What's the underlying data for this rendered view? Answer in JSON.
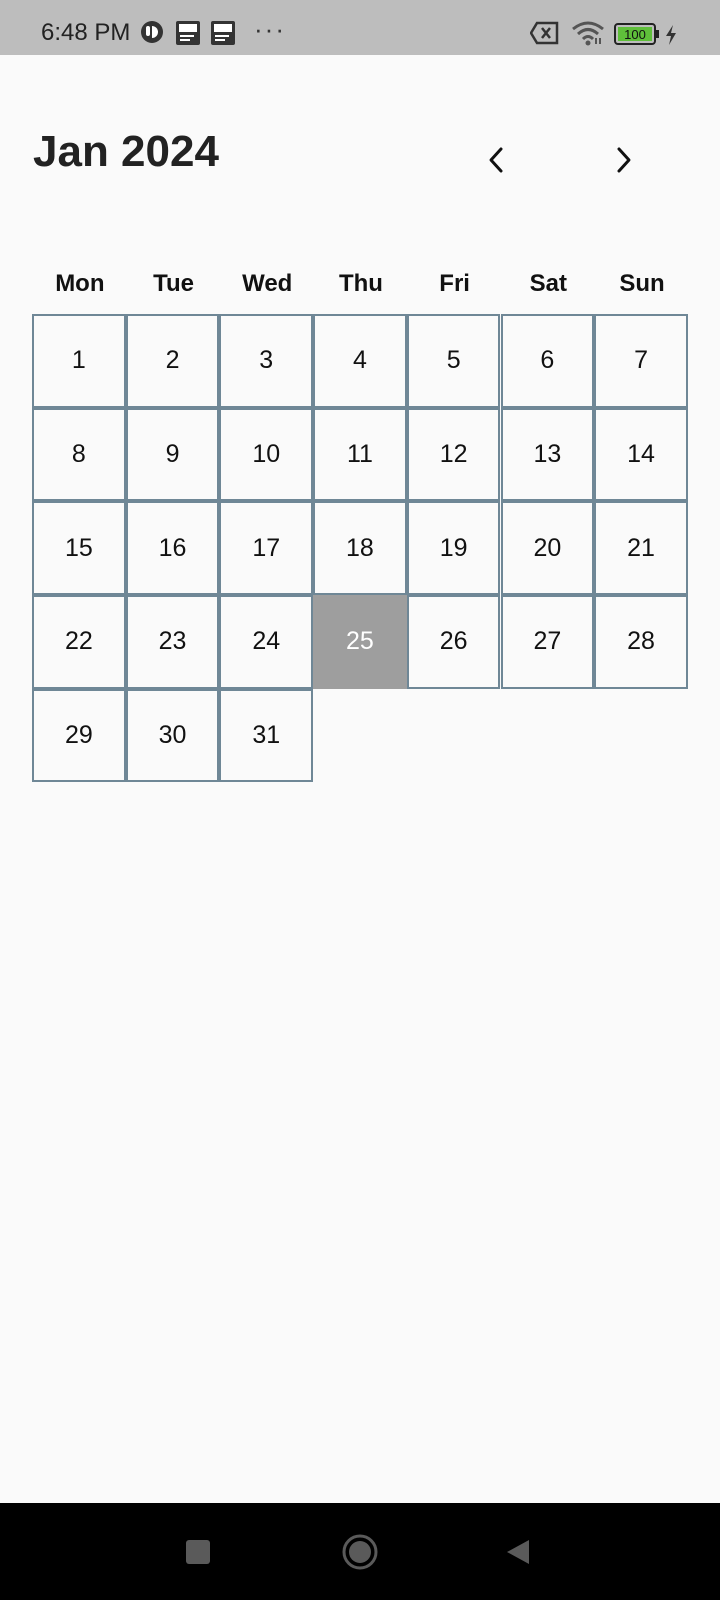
{
  "status_bar": {
    "time": "6:48 PM",
    "dots": "···",
    "battery": "100",
    "icons": [
      "notification-badge-icon",
      "document-icon",
      "document-icon",
      "no-sim-icon",
      "wifi-icon",
      "battery-icon",
      "charging-icon"
    ]
  },
  "calendar": {
    "month_label": "Jan 2024",
    "weekdays": [
      "Mon",
      "Tue",
      "Wed",
      "Thu",
      "Fri",
      "Sat",
      "Sun"
    ],
    "days": [
      "1",
      "2",
      "3",
      "4",
      "5",
      "6",
      "7",
      "8",
      "9",
      "10",
      "11",
      "12",
      "13",
      "14",
      "15",
      "16",
      "17",
      "18",
      "19",
      "20",
      "21",
      "22",
      "23",
      "24",
      "25",
      "26",
      "27",
      "28",
      "29",
      "30",
      "31"
    ],
    "first_weekday_index": 0,
    "selected_day": "25",
    "selected_color": "#9e9e9e",
    "border_color": "#6f8796"
  },
  "nav_bar": {
    "icons": [
      "recents-icon",
      "home-icon",
      "back-icon"
    ]
  }
}
